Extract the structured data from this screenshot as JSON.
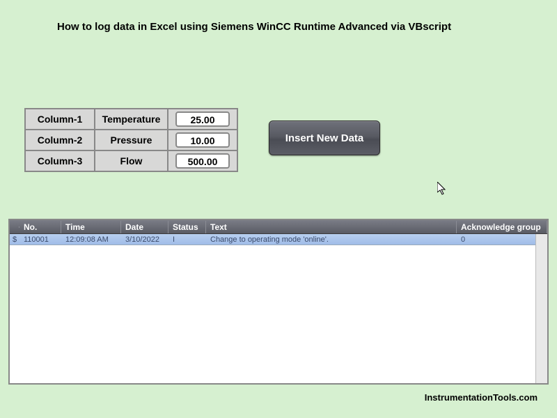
{
  "title": "How to log data in Excel using Siemens WinCC Runtime Advanced via VBscript",
  "table": {
    "rows": [
      {
        "col": "Column-1",
        "label": "Temperature",
        "value": "25.00"
      },
      {
        "col": "Column-2",
        "label": "Pressure",
        "value": "10.00"
      },
      {
        "col": "Column-3",
        "label": "Flow",
        "value": "500.00"
      }
    ]
  },
  "button": {
    "insert": "Insert New Data"
  },
  "msg": {
    "headers": {
      "no": "No.",
      "time": "Time",
      "date": "Date",
      "status": "Status",
      "text": "Text",
      "ack": "Acknowledge group"
    },
    "rows": [
      {
        "sym": "$",
        "no": "110001",
        "time": "12:09:08 AM",
        "date": "3/10/2022",
        "status": "I",
        "text": "Change to operating mode 'online'.",
        "ack": "0"
      }
    ]
  },
  "footer": "InstrumentationTools.com"
}
